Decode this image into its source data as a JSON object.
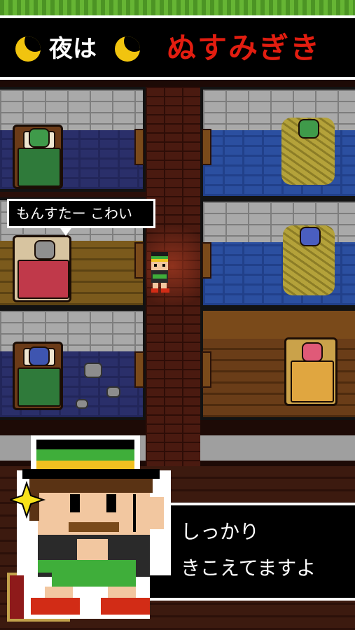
{
  "header": {
    "night_label": "夜は",
    "role": "ぬすみぎき",
    "icon": "crescent-moon-icon",
    "role_color": "#e21d10"
  },
  "speech_bubble": {
    "text": "もんすたー こわい"
  },
  "dialogue": {
    "line1": "しっかり",
    "line2": "きこえてますよ"
  }
}
